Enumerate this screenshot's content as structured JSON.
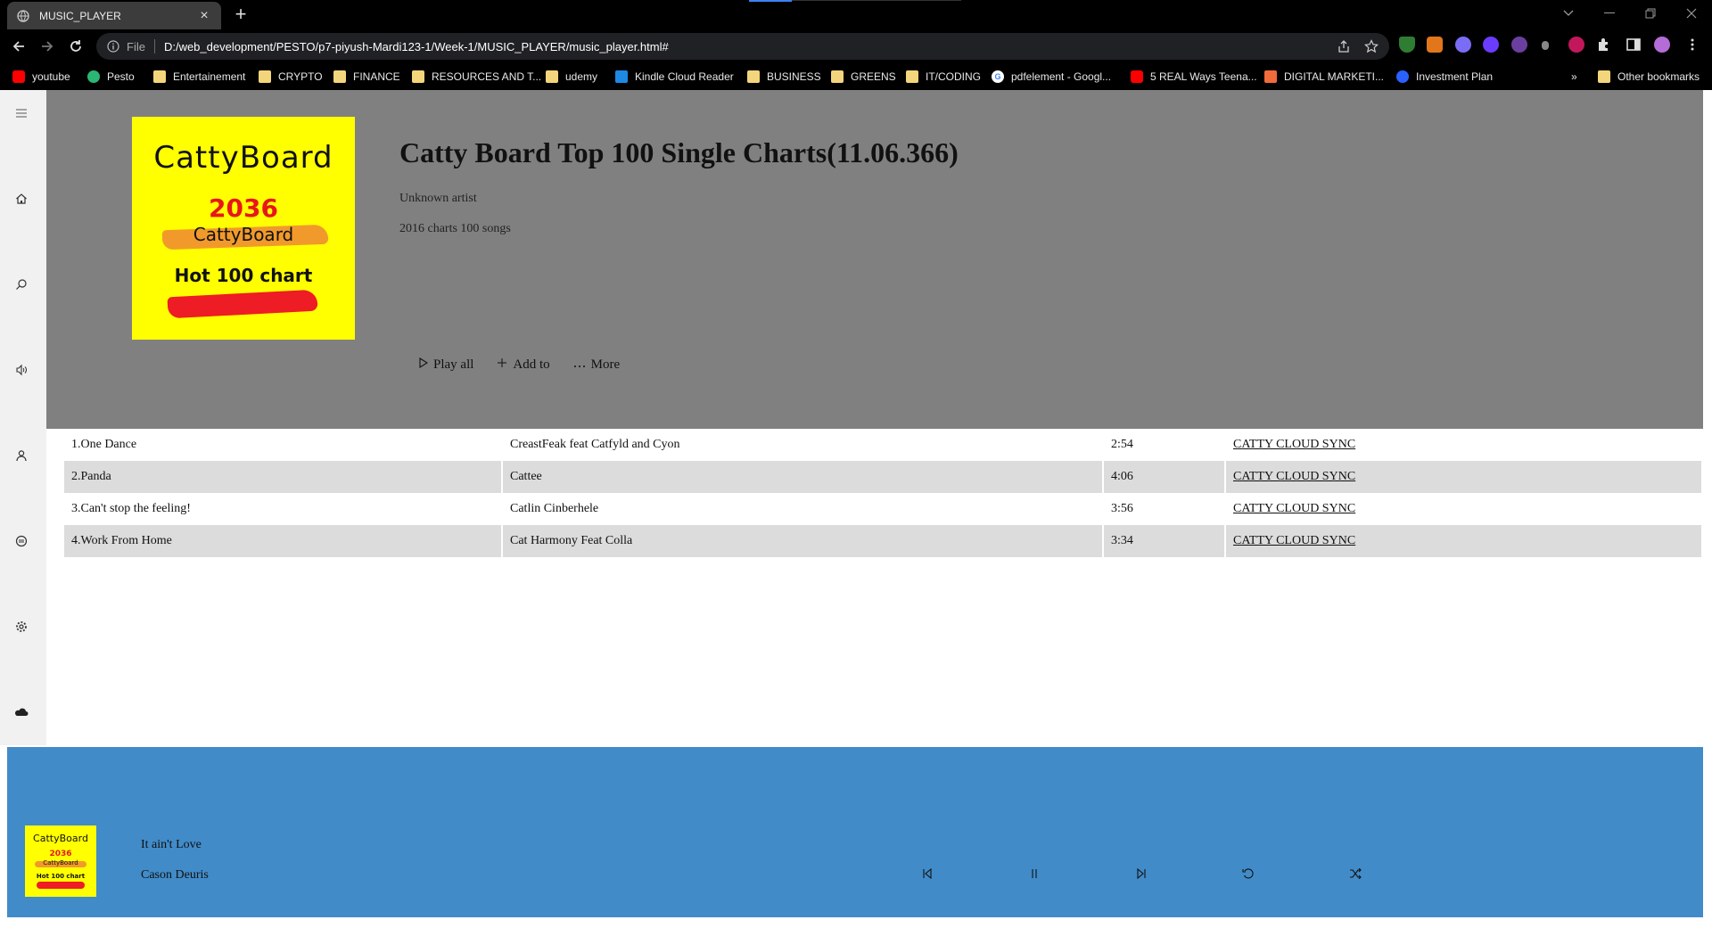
{
  "browser": {
    "tab_title": "MUSIC_PLAYER",
    "tab_close": "×",
    "new_tab": "+",
    "file_label": "File",
    "url": "D:/web_development/PESTO/p7-piyush-Mardi123-1/Week-1/MUSIC_PLAYER/music_player.html#",
    "bookmarks": [
      {
        "label": "youtube",
        "icon": "youtube-icon",
        "color": "#ff0000"
      },
      {
        "label": "Pesto",
        "icon": "pesto-icon",
        "color": "#2bb673"
      },
      {
        "label": "Entertainement",
        "icon": "folder-icon"
      },
      {
        "label": "CRYPTO",
        "icon": "folder-icon"
      },
      {
        "label": "FINANCE",
        "icon": "folder-icon"
      },
      {
        "label": "RESOURCES AND T...",
        "icon": "folder-icon"
      },
      {
        "label": "udemy",
        "icon": "folder-icon"
      },
      {
        "label": "Kindle Cloud Reader",
        "icon": "kindle-icon",
        "color": "#1e88e5"
      },
      {
        "label": "BUSINESS",
        "icon": "folder-icon"
      },
      {
        "label": "GREENS",
        "icon": "folder-icon"
      },
      {
        "label": "IT/CODING",
        "icon": "folder-icon"
      },
      {
        "label": "pdfelement - Googl...",
        "icon": "google-icon"
      },
      {
        "label": "5 REAL Ways Teena...",
        "icon": "youtube-icon",
        "color": "#ff0000"
      },
      {
        "label": "DIGITAL MARKETI...",
        "icon": "digital-icon",
        "color": "#f26b3a"
      },
      {
        "label": "Investment Plan",
        "icon": "pb-icon",
        "color": "#2962ff"
      }
    ],
    "more_bookmarks": "»",
    "other_bookmarks": "Other bookmarks"
  },
  "sidebar": {
    "items": [
      "menu-icon",
      "home-icon",
      "search-icon",
      "speaker-icon",
      "user-icon",
      "disc-icon",
      "settings-icon",
      "cloud-icon"
    ]
  },
  "album": {
    "cover": {
      "brand": "CattyBoard",
      "year": "2036",
      "brand_small": "CattyBoard",
      "chart": "Hot 100 chart"
    },
    "title": "Catty Board Top 100 Single Charts(11.06.366)",
    "artist": "Unknown artist",
    "meta": "2016 charts 100 songs",
    "actions": {
      "play_all": "Play all",
      "add_to": "Add to",
      "more": "More"
    }
  },
  "tracks": [
    {
      "title": "1.One Dance",
      "artist": "CreastFeak feat Catfyld and Cyon",
      "duration": "2:54",
      "source": "CATTY CLOUD SYNC"
    },
    {
      "title": "2.Panda",
      "artist": "Cattee",
      "duration": "4:06",
      "source": "CATTY CLOUD SYNC"
    },
    {
      "title": "3.Can't stop the feeling!",
      "artist": "Catlin Cinberhele",
      "duration": "3:56",
      "source": "CATTY CLOUD SYNC"
    },
    {
      "title": "4.Work From Home",
      "artist": "Cat Harmony Feat Colla",
      "duration": "3:34",
      "source": "CATTY CLOUD SYNC"
    }
  ],
  "player": {
    "now_playing_title": "It ain't Love",
    "now_playing_artist": "Cason Deuris",
    "controls": [
      "previous-icon",
      "pause-icon",
      "next-icon",
      "repeat-icon",
      "shuffle-icon"
    ],
    "bar_color": "#418bc8"
  },
  "colors": {
    "hero_bg": "#808080",
    "cover_bg": "#ffff00",
    "row_alt": "#dcdcdc",
    "sidebar_bg": "#f1f1f1"
  }
}
